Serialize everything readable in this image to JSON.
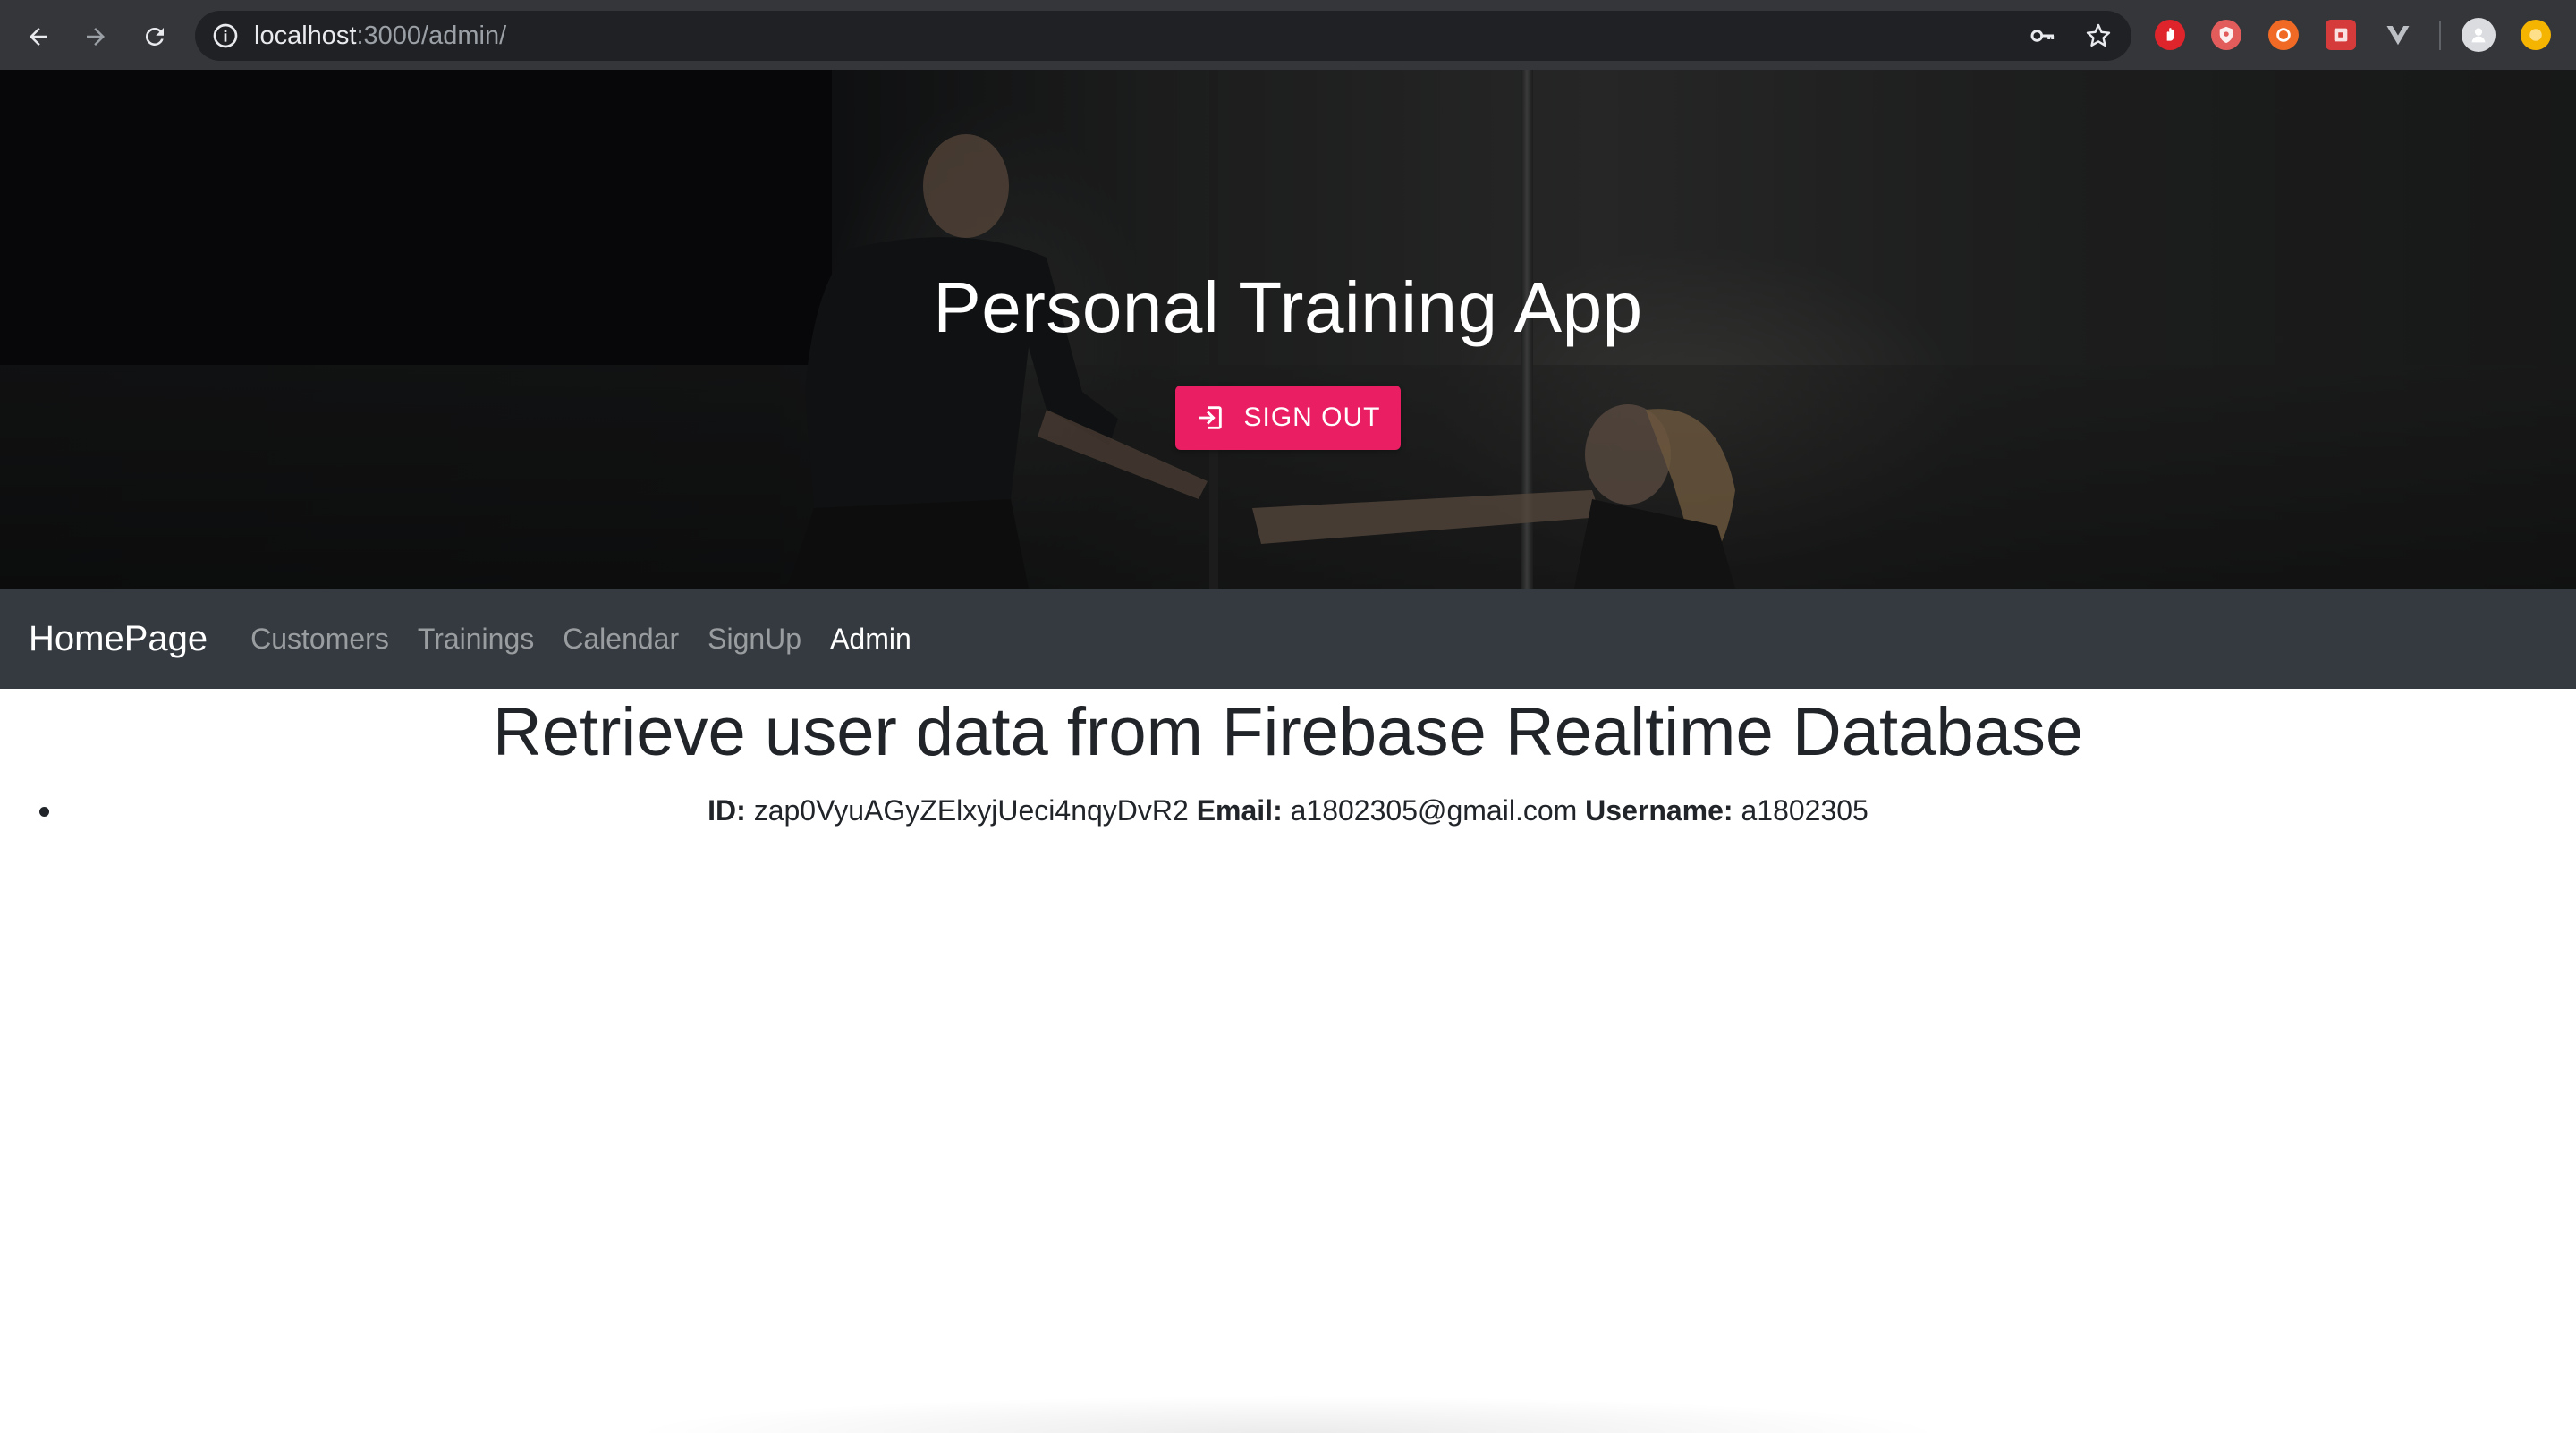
{
  "browser": {
    "url_host": "localhost",
    "url_path": ":3000/admin/"
  },
  "hero": {
    "title": "Personal Training App",
    "signout_label": "SIGN OUT"
  },
  "navbar": {
    "brand": "HomePage",
    "links": [
      "Customers",
      "Trainings",
      "Calendar",
      "SignUp",
      "Admin"
    ],
    "active": "Admin"
  },
  "main": {
    "heading": "Retrieve user data from Firebase Realtime Database",
    "users": [
      {
        "id_label": "ID:",
        "id": "zap0VyuAGyZElxyjUeci4nqyDvR2",
        "email_label": "Email:",
        "email": "a1802305@gmail.com",
        "username_label": "Username:",
        "username": "a1802305"
      }
    ]
  },
  "colors": {
    "accent": "#e91e63",
    "navbar": "#343a40",
    "chrome": "#35363a"
  }
}
